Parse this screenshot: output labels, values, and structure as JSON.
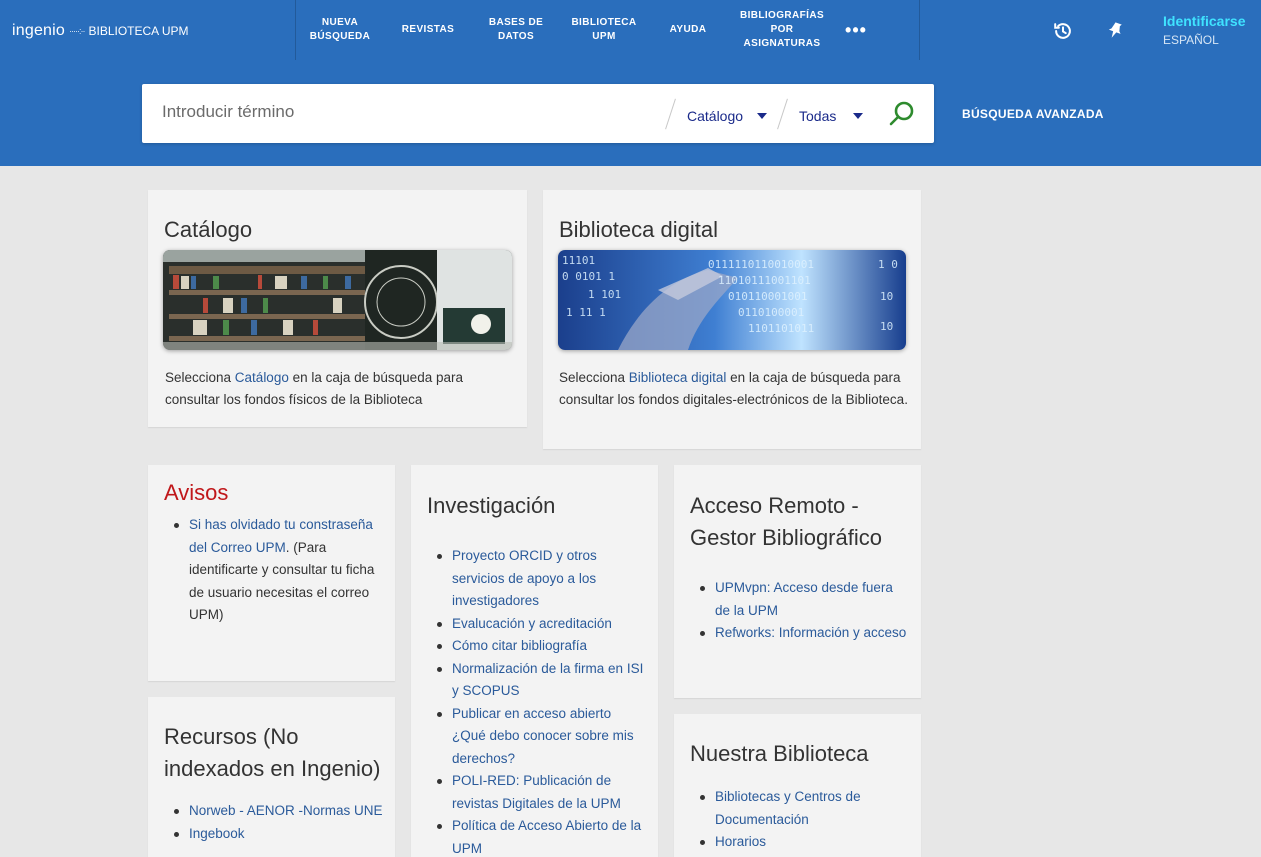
{
  "logo": {
    "ingenio": "ingenio",
    "dots": "·····:··",
    "biblioteca": "BIBLIOTECA UPM"
  },
  "nav": {
    "items": [
      {
        "line1": "NUEVA",
        "line2": "BÚSQUEDA"
      },
      {
        "line1": "REVISTAS",
        "line2": ""
      },
      {
        "line1": "BASES DE",
        "line2": "DATOS"
      },
      {
        "line1": "BIBLIOTECA",
        "line2": "UPM"
      },
      {
        "line1": "AYUDA",
        "line2": ""
      },
      {
        "line1": "BIBLIOGRAFÍAS",
        "line2": "POR",
        "line3": "ASIGNATURAS"
      }
    ],
    "more": "•••"
  },
  "header": {
    "login": "Identificarse",
    "language": "ESPAÑOL",
    "history_icon": "history-icon",
    "pin_icon": "pin-icon"
  },
  "search": {
    "placeholder": "Introducir término",
    "scope": "Catálogo",
    "filter": "Todas",
    "advanced": "BÚSQUEDA AVANZADA",
    "search_icon": "search-icon"
  },
  "catalogo": {
    "title": "Catálogo",
    "text_pre": "Selecciona ",
    "link": "Catálogo",
    "text_post": " en la caja de búsqueda para consultar los fondos físicos de la Biblioteca"
  },
  "digital": {
    "title": "Biblioteca digital",
    "text_pre": "Selecciona ",
    "link": "Biblioteca digital",
    "text_post": " en la caja de búsqueda para consultar los fondos digitales-electrónicos de la Biblioteca."
  },
  "avisos": {
    "title": "Avisos",
    "item_link": "Si has olvidado tu constraseña del Correo UPM",
    "item_text": ". (Para identificarte y consultar tu ficha de usuario necesitas el correo UPM)"
  },
  "investigacion": {
    "title": "Investigación",
    "items": [
      "Proyecto ORCID y otros servicios de apoyo a los investigadores",
      "Evalucación y acreditación",
      "Cómo citar bibliografía",
      "Normalización de la firma en ISI y SCOPUS",
      "Publicar en acceso abierto ¿Qué debo conocer sobre mis derechos?",
      "POLI-RED: Publicación de revistas Digitales de la UPM",
      "Política de Acceso Abierto de la UPM"
    ]
  },
  "acceso": {
    "title_line1": "Acceso Remoto -",
    "title_line2": "Gestor Bibliográfico",
    "items": [
      "UPMvpn: Acceso desde fuera de la UPM",
      "Refworks: Información y acceso"
    ]
  },
  "recursos": {
    "title_line1": "Recursos (No",
    "title_line2": "indexados en Ingenio)",
    "items": [
      "Norweb - AENOR -Normas UNE",
      "Ingebook"
    ]
  },
  "nuestra": {
    "title": "Nuestra Biblioteca",
    "items": [
      "Bibliotecas y Centros de Documentación",
      "Horarios"
    ]
  },
  "colors": {
    "header": "#2a6ebc",
    "accent_login": "#3fe3ff",
    "avisos_title": "#c0171a",
    "link": "#2a5a9a",
    "search_go": "#2e8b2e"
  }
}
